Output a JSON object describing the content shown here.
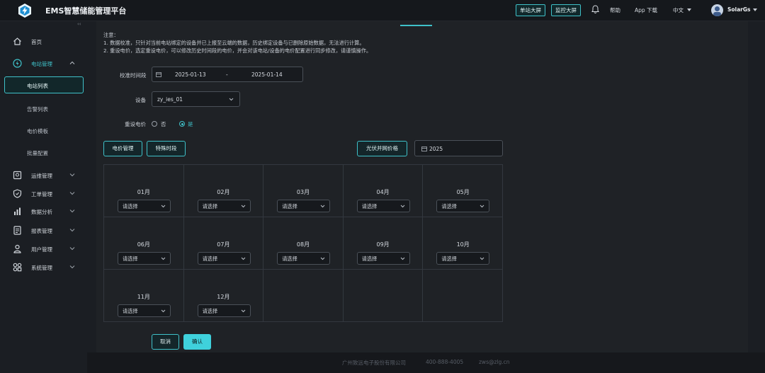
{
  "header": {
    "title": "EMS智慧储能管理平台",
    "btn_station_screen": "单站大屏",
    "btn_monitor_screen": "监控大屏",
    "help": "帮助",
    "app_download": "App 下载",
    "language": "中文",
    "user": "SolarGs",
    "icons": [
      "bolt-logo",
      "bell-icon",
      "chevron-down-icon",
      "avatar"
    ],
    "accent_color": "#3fc1c9"
  },
  "sidebar": {
    "collapse": "‹‹",
    "items": [
      {
        "label": "首页",
        "icon": "home-icon"
      },
      {
        "label": "电站管理",
        "icon": "station-icon",
        "expanded": true
      },
      {
        "label": "运维管理",
        "icon": "monitor-icon"
      },
      {
        "label": "工单管理",
        "icon": "shield-icon"
      },
      {
        "label": "数据分析",
        "icon": "chart-icon"
      },
      {
        "label": "报表管理",
        "icon": "report-icon"
      },
      {
        "label": "用户管理",
        "icon": "user-icon"
      },
      {
        "label": "系统管理",
        "icon": "apps-icon"
      }
    ],
    "subitems": [
      {
        "label": "电站列表",
        "active": true
      },
      {
        "label": "告警列表"
      },
      {
        "label": "电价模板"
      },
      {
        "label": "批量配置"
      }
    ]
  },
  "notes": {
    "title": "注意：",
    "line1": "1. 数据校准，只针对当前电站绑定的设备并已上报至云端的数据，历史绑定设备与已删除原始数据，无法进行计算。",
    "line2": "2. 重设电价，选定重设电价，可以修改历史时间段的电价，并会对该电站/设备的电价配置进行同步修改，请谨慎操作。"
  },
  "form": {
    "period_label": "校准时间段",
    "start_date": "2025-01-13",
    "range_sep": "-",
    "end_date": "2025-01-14",
    "device_label": "设备",
    "device_value": "zy_ies_01",
    "reset_price_label": "重设电价",
    "option_no": "否",
    "option_yes": "是",
    "selected_option": "是"
  },
  "actions": {
    "price_mgmt": "电价管理",
    "special_period": "特殊时段",
    "pv_grid_price": "光伏并网价格",
    "year": "2025"
  },
  "months": [
    {
      "label": "01月",
      "placeholder": "请选择"
    },
    {
      "label": "02月",
      "placeholder": "请选择"
    },
    {
      "label": "03月",
      "placeholder": "请选择"
    },
    {
      "label": "04月",
      "placeholder": "请选择"
    },
    {
      "label": "05月",
      "placeholder": "请选择"
    },
    {
      "label": "06月",
      "placeholder": "请选择"
    },
    {
      "label": "07月",
      "placeholder": "请选择"
    },
    {
      "label": "08月",
      "placeholder": "请选择"
    },
    {
      "label": "09月",
      "placeholder": "请选择"
    },
    {
      "label": "10月",
      "placeholder": "请选择"
    },
    {
      "label": "11月",
      "placeholder": "请选择"
    },
    {
      "label": "12月",
      "placeholder": "请选择"
    }
  ],
  "buttons": {
    "cancel": "取消",
    "confirm": "确认"
  },
  "footer": {
    "company": "广州致远电子股份有限公司",
    "phone": "400-888-4005",
    "email": "zws@zlg.cn"
  }
}
